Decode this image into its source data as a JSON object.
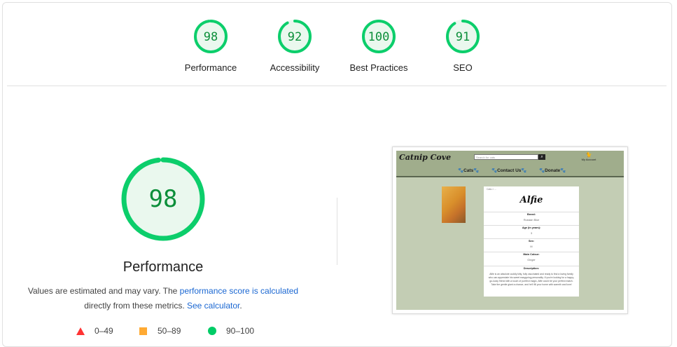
{
  "summary": [
    {
      "score": "98",
      "label": "Performance",
      "value": 98
    },
    {
      "score": "92",
      "label": "Accessibility",
      "value": 92
    },
    {
      "score": "100",
      "label": "Best Practices",
      "value": 100
    },
    {
      "score": "91",
      "label": "SEO",
      "value": 91
    }
  ],
  "performance": {
    "score": "98",
    "value": 98,
    "title": "Performance",
    "desc_part1": "Values are estimated and may vary. The ",
    "desc_link1": "performance score is calculated",
    "desc_part2": "directly from these metrics. ",
    "desc_link2": "See calculator",
    "desc_end": "."
  },
  "legend": [
    {
      "range": "0–49",
      "shape": "triangle",
      "color": "#f33"
    },
    {
      "range": "50–89",
      "shape": "square",
      "color": "#fa3"
    },
    {
      "range": "90–100",
      "shape": "circle",
      "color": "#0c6"
    }
  ],
  "colors": {
    "pass": "#0cce6b",
    "pass_text": "#0c8f3a",
    "pass_bg": "#eaf8ee"
  },
  "screenshot": {
    "logo": "Catnip Cove",
    "search_placeholder": "Search for cats",
    "account": "My Account",
    "nav": [
      "Cats",
      "Contact Us",
      "Donate"
    ],
    "breadcrumb": "Cats > ...",
    "cat_name": "Alfie",
    "fields": [
      {
        "label": "Breed:",
        "value": "Russian Blue"
      },
      {
        "label": "Age (in years):",
        "value": "3"
      },
      {
        "label": "Sex:",
        "value": "M"
      },
      {
        "label": "Main Colour:",
        "value": "Ginger"
      },
      {
        "label": "Description:",
        "value": ""
      }
    ],
    "description": "Alfie is an absolute cuddly kitty, fully vaccinated and ready to find a loving family who can appreciate his sweet easygoing personality. If you're looking for a happy-go-lucky friend with a touch of purrfect magic, Alfie could be your perfect match. Take the gentle giant a chance, and he'll fill your home with warmth and love!"
  }
}
